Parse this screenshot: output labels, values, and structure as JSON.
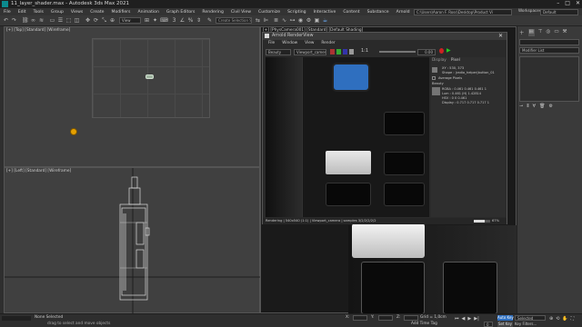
{
  "window": {
    "title": "11_layer_shader.max - Autodesk 3ds Max 2021",
    "controls": [
      "–",
      "□",
      "✕"
    ]
  },
  "menu": [
    "File",
    "Edit",
    "Tools",
    "Group",
    "Views",
    "Create",
    "Modifiers",
    "Animation",
    "Graph Editors",
    "Rendering",
    "Civil View",
    "Customize",
    "Scripting",
    "Interactive",
    "Content",
    "Substance",
    "Arnold",
    "Help"
  ],
  "top_right": {
    "path": "C:\\Users\\Aaron F. Ross\\Desktop\\Product Vi",
    "workspaces_label": "Workspaces:",
    "workspaces_value": "Default"
  },
  "toolbar": {
    "view_value": "View",
    "selection_set_placeholder": "Create Selection Se"
  },
  "viewports": {
    "top": "[+] [Top] [Standard] [Wireframe]",
    "left": "[+] [Left] [Standard] [Wireframe]",
    "camera": "[+] [PhysCamera001] [Standard] [Default Shading]"
  },
  "render_view": {
    "title": "Arnold RenderView",
    "menus": [
      "File",
      "Window",
      "View",
      "Render"
    ],
    "camera_dropdown": "Viewport_camera",
    "aov_dropdown": "Beauty",
    "exposure": "0.00",
    "tabs": [
      "Display",
      "Pixel"
    ],
    "xy": "XY : 530, 373",
    "shape": "Shape : |radio_helper|button_01",
    "average_pixels": "Average Pixels",
    "beauty": "Beauty",
    "rgba": "RGBA : 0.461 0.461 0.461 1",
    "lum": "Lum : 0.461 (H) 1.42814",
    "hsv": "HSV : 0 0 0.461",
    "display": "Display : 0.717 0.717 0.717 1",
    "status_text": "Rendering | 540x540 (1:1) | Viewport_camera | samples 3/2/2/2/2/2",
    "progress_percent": "67%"
  },
  "command_panel": {
    "modifier_list": "Modifier List"
  },
  "status": {
    "selection": "None Selected",
    "hint": "drag to select and move objects",
    "x_label": "X:",
    "y_label": "Y:",
    "z_label": "Z:",
    "grid": "Grid = 1,0cm",
    "add_time_tag": "Add Time Tag",
    "auto_key": "Auto Key",
    "selected": "Selected",
    "set_key": "Set Key",
    "key_filters": "Key Filters...",
    "frame": "0"
  },
  "colors": {
    "accent_blue": "#2e6fc0",
    "button_blue": "#2f6fbf",
    "render_bg": "#111111"
  }
}
